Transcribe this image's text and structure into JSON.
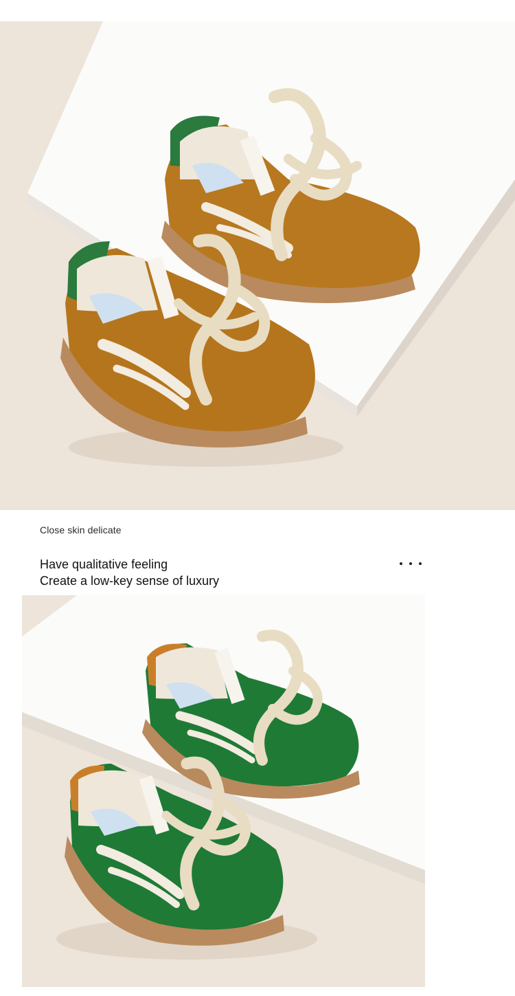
{
  "section": {
    "caption": "Close skin delicate",
    "heading_line1": "Have qualitative feeling",
    "heading_line2": "Create a low-key sense of luxury"
  },
  "photos": [
    {
      "subject": "mustard-suede-toddler-sneakers",
      "upper_color": "#b7761c",
      "accent_color": "#2b7a3e",
      "sole_color": "#b98a5d",
      "background_color": "#ece2d8"
    },
    {
      "subject": "green-suede-toddler-sneakers",
      "upper_color": "#1f7a36",
      "accent_color": "#c97f2a",
      "sole_color": "#b98a5d",
      "background_color": "#ece2d8"
    }
  ],
  "icons": {
    "more": "more-dots-icon"
  }
}
